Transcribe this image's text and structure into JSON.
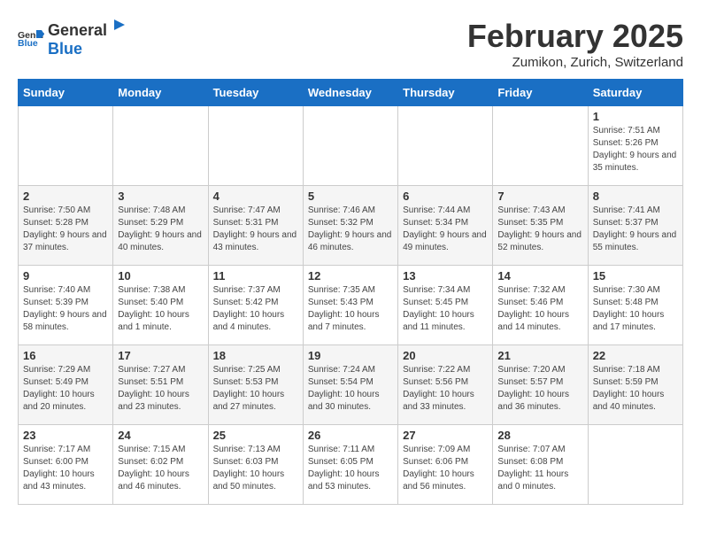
{
  "header": {
    "logo_general": "General",
    "logo_blue": "Blue",
    "month_title": "February 2025",
    "location": "Zumikon, Zurich, Switzerland"
  },
  "days_of_week": [
    "Sunday",
    "Monday",
    "Tuesday",
    "Wednesday",
    "Thursday",
    "Friday",
    "Saturday"
  ],
  "weeks": [
    [
      {
        "day": "",
        "info": ""
      },
      {
        "day": "",
        "info": ""
      },
      {
        "day": "",
        "info": ""
      },
      {
        "day": "",
        "info": ""
      },
      {
        "day": "",
        "info": ""
      },
      {
        "day": "",
        "info": ""
      },
      {
        "day": "1",
        "info": "Sunrise: 7:51 AM\nSunset: 5:26 PM\nDaylight: 9 hours and 35 minutes."
      }
    ],
    [
      {
        "day": "2",
        "info": "Sunrise: 7:50 AM\nSunset: 5:28 PM\nDaylight: 9 hours and 37 minutes."
      },
      {
        "day": "3",
        "info": "Sunrise: 7:48 AM\nSunset: 5:29 PM\nDaylight: 9 hours and 40 minutes."
      },
      {
        "day": "4",
        "info": "Sunrise: 7:47 AM\nSunset: 5:31 PM\nDaylight: 9 hours and 43 minutes."
      },
      {
        "day": "5",
        "info": "Sunrise: 7:46 AM\nSunset: 5:32 PM\nDaylight: 9 hours and 46 minutes."
      },
      {
        "day": "6",
        "info": "Sunrise: 7:44 AM\nSunset: 5:34 PM\nDaylight: 9 hours and 49 minutes."
      },
      {
        "day": "7",
        "info": "Sunrise: 7:43 AM\nSunset: 5:35 PM\nDaylight: 9 hours and 52 minutes."
      },
      {
        "day": "8",
        "info": "Sunrise: 7:41 AM\nSunset: 5:37 PM\nDaylight: 9 hours and 55 minutes."
      }
    ],
    [
      {
        "day": "9",
        "info": "Sunrise: 7:40 AM\nSunset: 5:39 PM\nDaylight: 9 hours and 58 minutes."
      },
      {
        "day": "10",
        "info": "Sunrise: 7:38 AM\nSunset: 5:40 PM\nDaylight: 10 hours and 1 minute."
      },
      {
        "day": "11",
        "info": "Sunrise: 7:37 AM\nSunset: 5:42 PM\nDaylight: 10 hours and 4 minutes."
      },
      {
        "day": "12",
        "info": "Sunrise: 7:35 AM\nSunset: 5:43 PM\nDaylight: 10 hours and 7 minutes."
      },
      {
        "day": "13",
        "info": "Sunrise: 7:34 AM\nSunset: 5:45 PM\nDaylight: 10 hours and 11 minutes."
      },
      {
        "day": "14",
        "info": "Sunrise: 7:32 AM\nSunset: 5:46 PM\nDaylight: 10 hours and 14 minutes."
      },
      {
        "day": "15",
        "info": "Sunrise: 7:30 AM\nSunset: 5:48 PM\nDaylight: 10 hours and 17 minutes."
      }
    ],
    [
      {
        "day": "16",
        "info": "Sunrise: 7:29 AM\nSunset: 5:49 PM\nDaylight: 10 hours and 20 minutes."
      },
      {
        "day": "17",
        "info": "Sunrise: 7:27 AM\nSunset: 5:51 PM\nDaylight: 10 hours and 23 minutes."
      },
      {
        "day": "18",
        "info": "Sunrise: 7:25 AM\nSunset: 5:53 PM\nDaylight: 10 hours and 27 minutes."
      },
      {
        "day": "19",
        "info": "Sunrise: 7:24 AM\nSunset: 5:54 PM\nDaylight: 10 hours and 30 minutes."
      },
      {
        "day": "20",
        "info": "Sunrise: 7:22 AM\nSunset: 5:56 PM\nDaylight: 10 hours and 33 minutes."
      },
      {
        "day": "21",
        "info": "Sunrise: 7:20 AM\nSunset: 5:57 PM\nDaylight: 10 hours and 36 minutes."
      },
      {
        "day": "22",
        "info": "Sunrise: 7:18 AM\nSunset: 5:59 PM\nDaylight: 10 hours and 40 minutes."
      }
    ],
    [
      {
        "day": "23",
        "info": "Sunrise: 7:17 AM\nSunset: 6:00 PM\nDaylight: 10 hours and 43 minutes."
      },
      {
        "day": "24",
        "info": "Sunrise: 7:15 AM\nSunset: 6:02 PM\nDaylight: 10 hours and 46 minutes."
      },
      {
        "day": "25",
        "info": "Sunrise: 7:13 AM\nSunset: 6:03 PM\nDaylight: 10 hours and 50 minutes."
      },
      {
        "day": "26",
        "info": "Sunrise: 7:11 AM\nSunset: 6:05 PM\nDaylight: 10 hours and 53 minutes."
      },
      {
        "day": "27",
        "info": "Sunrise: 7:09 AM\nSunset: 6:06 PM\nDaylight: 10 hours and 56 minutes."
      },
      {
        "day": "28",
        "info": "Sunrise: 7:07 AM\nSunset: 6:08 PM\nDaylight: 11 hours and 0 minutes."
      },
      {
        "day": "",
        "info": ""
      }
    ]
  ]
}
